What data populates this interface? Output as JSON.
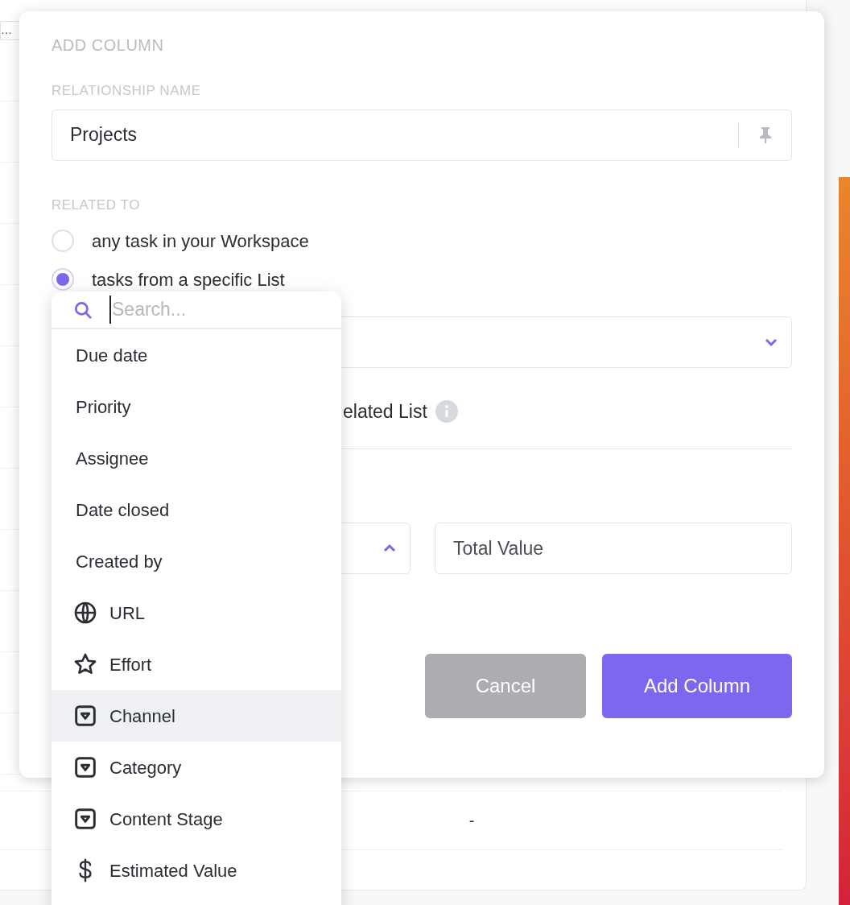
{
  "background": {
    "top_cell": "…",
    "row_value": "-"
  },
  "modal": {
    "title": "ADD COLUMN",
    "name_label": "RELATIONSHIP NAME",
    "name_value": "Projects",
    "related_label": "RELATED TO",
    "options": [
      {
        "label": "any task in your Workspace",
        "selected": false
      },
      {
        "label": "tasks from a specific List",
        "selected": true
      }
    ],
    "partial_text": "elated List",
    "rollup_value": "Total Value",
    "buttons": [
      {
        "label": "Cancel",
        "kind": "secondary"
      },
      {
        "label": "Add Column",
        "kind": "primary"
      }
    ]
  },
  "dropdown": {
    "placeholder": "Search...",
    "items": [
      {
        "label": "Due date",
        "kind": "plain",
        "selected": false
      },
      {
        "label": "Priority",
        "kind": "plain",
        "selected": false
      },
      {
        "label": "Assignee",
        "kind": "plain",
        "selected": false
      },
      {
        "label": "Date closed",
        "kind": "plain",
        "selected": false
      },
      {
        "label": "Created by",
        "kind": "plain",
        "selected": false
      },
      {
        "label": "URL",
        "kind": "globe",
        "selected": false
      },
      {
        "label": "Effort",
        "kind": "star",
        "selected": false
      },
      {
        "label": "Channel",
        "kind": "dropdown",
        "selected": true
      },
      {
        "label": "Category",
        "kind": "dropdown",
        "selected": false
      },
      {
        "label": "Content Stage",
        "kind": "dropdown",
        "selected": false
      },
      {
        "label": "Estimated Value",
        "kind": "dollar",
        "selected": false
      }
    ]
  }
}
